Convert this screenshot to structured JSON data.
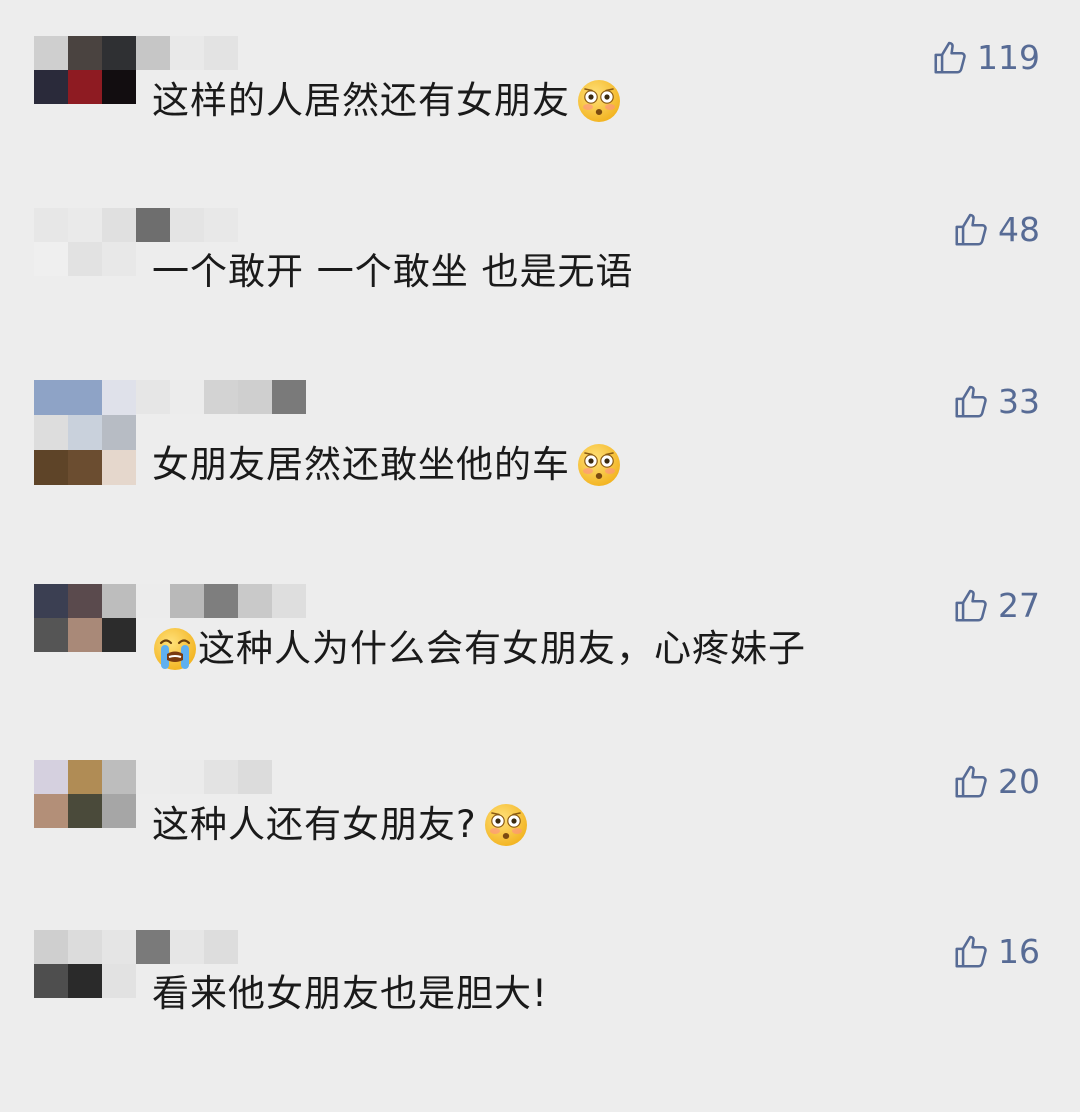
{
  "comments": [
    {
      "text": "这样的人居然还有女朋友",
      "emoji_before": "",
      "emoji_after": "flushed-face-icon",
      "likes": "119",
      "avatar": [
        "#cfcfcf",
        "#4a4340",
        "#2f3033",
        "#2a2a3a",
        "#8e1b22",
        "#120d10"
      ],
      "nick": [
        [
          "#c6c6c6",
          34
        ],
        [
          "#e9e9e9",
          34
        ],
        [
          "#e3e3e3",
          34
        ]
      ]
    },
    {
      "text": "一个敢开 一个敢坐  也是无语",
      "emoji_before": "",
      "emoji_after": "",
      "likes": "48",
      "avatar": [
        "#e7e7e7",
        "#eaeaea",
        "#e0e0e0",
        "#efefef",
        "#e2e2e2",
        "#e8e8e8"
      ],
      "nick": [
        [
          "#6e6e6e",
          34
        ],
        [
          "#e4e4e4",
          34
        ],
        [
          "#e8e8e8",
          34
        ]
      ]
    },
    {
      "text": "女朋友居然还敢坐他的车",
      "emoji_before": "",
      "emoji_after": "flushed-face-icon",
      "likes": "33",
      "avatar": [
        "#8ea3c6",
        "#8ea3c6",
        "#dfe1ea",
        "#dddddd",
        "#c9d1dc",
        "#b7bcc4",
        "#5e4428",
        "#6b4d30",
        "#e5d7cc"
      ],
      "nick": [
        [
          "#e6e6e6",
          34
        ],
        [
          "#ececec",
          34
        ],
        [
          "#d3d3d3",
          34
        ],
        [
          "#cfcfcf",
          34
        ],
        [
          "#7a7a7a",
          34
        ]
      ]
    },
    {
      "text": "这种人为什么会有女朋友，心疼妹子",
      "emoji_before": "loudly-crying-face-icon",
      "emoji_after": "",
      "likes": "27",
      "avatar": [
        "#3b3f52",
        "#5a4a4d",
        "#bdbdbd",
        "#555555",
        "#a98978",
        "#2c2c2c"
      ],
      "nick": [
        [
          "#ececec",
          34
        ],
        [
          "#b9b9b9",
          34
        ],
        [
          "#7e7e7e",
          34
        ],
        [
          "#c9c9c9",
          34
        ],
        [
          "#dedede",
          34
        ]
      ]
    },
    {
      "text": "这种人还有女朋友?",
      "emoji_before": "",
      "emoji_after": "flushed-face-icon",
      "likes": "20",
      "avatar": [
        "#d5d0df",
        "#b08c55",
        "#bdbdbd",
        "#b38f78",
        "#4a4a3a",
        "#a6a6a6"
      ],
      "nick": [
        [
          "#ececec",
          34
        ],
        [
          "#ebebeb",
          34
        ],
        [
          "#e3e3e3",
          34
        ],
        [
          "#dcdcdc",
          34
        ]
      ]
    },
    {
      "text": "看来他女朋友也是胆大!",
      "emoji_before": "",
      "emoji_after": "",
      "likes": "16",
      "avatar": [
        "#cfcfcf",
        "#dcdcdc",
        "#e5e5e5",
        "#4e4e4e",
        "#2a2a2a",
        "#e2e2e2"
      ],
      "nick": [
        [
          "#7a7a7a",
          34
        ],
        [
          "#e6e6e6",
          34
        ],
        [
          "#dddddd",
          34
        ]
      ]
    }
  ],
  "icons": {
    "like": "thumbs-up-icon"
  },
  "colors": {
    "like": "#576b95",
    "text": "#1a1a1a",
    "background": "#ededed"
  }
}
